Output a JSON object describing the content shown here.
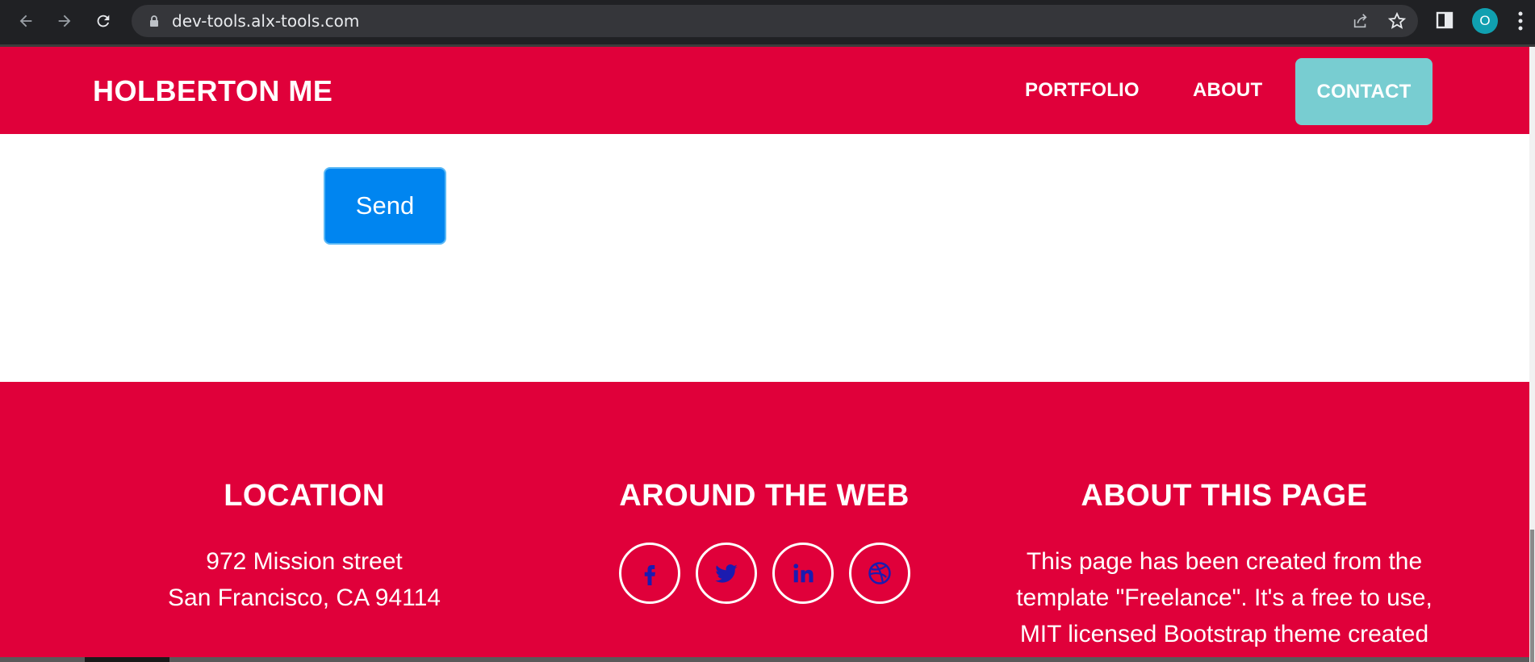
{
  "browser": {
    "url": "dev-tools.alx-tools.com",
    "profile_initial": "O",
    "icons": [
      "back-icon",
      "forward-icon",
      "reload-icon",
      "lock-icon",
      "share-icon",
      "star-icon",
      "side-panel-icon",
      "menu-icon"
    ]
  },
  "navbar": {
    "brand": "HOLBERTON ME",
    "links": {
      "portfolio": "PORTFOLIO",
      "about": "ABOUT",
      "contact": "CONTACT"
    },
    "bg_color": "#e0003a",
    "contact_bg_color": "#78cdd1"
  },
  "form": {
    "send_label": "Send",
    "button_color": "#0085f0"
  },
  "footer": {
    "location": {
      "heading": "LOCATION",
      "line1": "972 Mission street",
      "line2": "San Francisco, CA 94114"
    },
    "web": {
      "heading": "AROUND THE WEB",
      "icons": [
        "facebook-icon",
        "twitter-icon",
        "linkedin-icon",
        "dribbble-icon"
      ]
    },
    "about": {
      "heading": "ABOUT THIS PAGE",
      "line1": "This page has been created from the",
      "line2": "template \"Freelance\". It's a free to use,",
      "line3": "MIT licensed Bootstrap theme created"
    }
  }
}
